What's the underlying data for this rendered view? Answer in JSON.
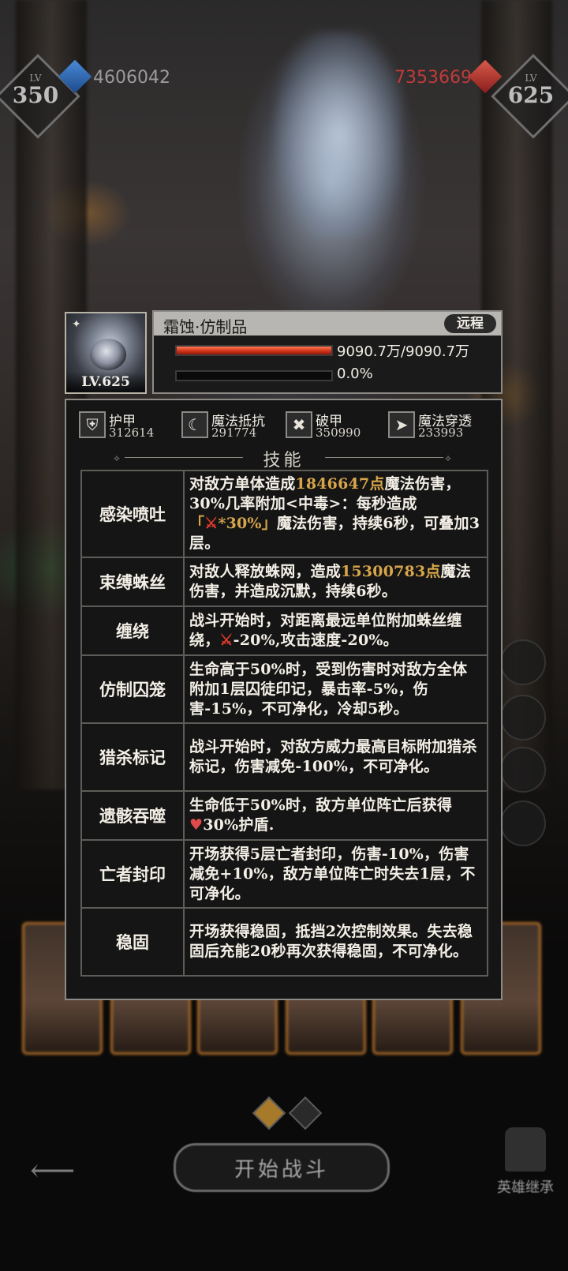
{
  "hud": {
    "player_level_label": "LV",
    "player_level": "350",
    "player_power": "4606042",
    "enemy_power": "7353669",
    "enemy_level_label": "LV",
    "enemy_level": "625"
  },
  "unit": {
    "portrait_level": "LV.625",
    "name": "霜蚀·仿制品",
    "type_badge": "远程",
    "hp_text": "9090.7万/9090.7万",
    "hp_fraction": 1.0,
    "energy_text": "0.0%",
    "energy_fraction": 0.0
  },
  "stats": [
    {
      "icon": "armor-icon",
      "label": "护甲",
      "value": "312614"
    },
    {
      "icon": "magic-resist-icon",
      "label": "魔法抵抗",
      "value": "291774"
    },
    {
      "icon": "armor-break-icon",
      "label": "破甲",
      "value": "350990"
    },
    {
      "icon": "magic-penetration-icon",
      "label": "魔法穿透",
      "value": "233993"
    }
  ],
  "skills_title": "技能",
  "skills": [
    {
      "name": "感染喷吐",
      "desc": [
        {
          "t": "对敌方单体造成"
        },
        {
          "t": "1846647点",
          "hl": true
        },
        {
          "t": "魔法伤害，30%几率附加<中毒>：每秒造成"
        },
        {
          "t": "「",
          "hl": true
        },
        {
          "icon": "sword"
        },
        {
          "t": "*30%」",
          "hl": true
        },
        {
          "t": "魔法伤害，持续6秒，可叠加3层。"
        }
      ]
    },
    {
      "name": "束缚蛛丝",
      "desc": [
        {
          "t": "对敌人释放蛛网，造成"
        },
        {
          "t": "15300783点",
          "hl": true
        },
        {
          "t": "魔法伤害，并造成沉默，持续6秒。"
        }
      ]
    },
    {
      "name": "缠绕",
      "desc": [
        {
          "t": "战斗开始时，对距离最远单位附加蛛丝缠绕，"
        },
        {
          "icon": "sword"
        },
        {
          "t": "-20%,攻击速度-20%。"
        }
      ]
    },
    {
      "name": "仿制囚笼",
      "desc": [
        {
          "t": "生命高于50%时，受到伤害时对敌方全体附加1层囚徒印记，暴击率-5%，伤害-15%，不可净化，冷却5秒。"
        }
      ]
    },
    {
      "name": "猎杀标记",
      "desc": [
        {
          "t": "战斗开始时，对敌方威力最高目标附加猎杀标记，伤害减免-100%，不可净化。"
        }
      ]
    },
    {
      "name": "遗骸吞噬",
      "desc": [
        {
          "t": "生命低于50%时，敌方单位阵亡后获得"
        },
        {
          "icon": "heart"
        },
        {
          "t": "30%护盾."
        }
      ]
    },
    {
      "name": "亡者封印",
      "desc": [
        {
          "t": "开场获得5层亡者封印，伤害-10%，伤害减免+10%，敌方单位阵亡时失去1层，不可净化。"
        }
      ]
    },
    {
      "name": "稳固",
      "desc": [
        {
          "t": "开场获得稳固，抵挡2次控制效果。失去稳固后充能20秒再次获得稳固，不可净化。"
        }
      ]
    }
  ],
  "bottom": {
    "start_button": "开始战斗",
    "inherit_label": "英雄继承"
  },
  "colors": {
    "highlight": "#d8a64a",
    "hp_bar": "#d2341a",
    "title_bar": "#b8b6b2",
    "panel_border": "#8c8a86"
  }
}
